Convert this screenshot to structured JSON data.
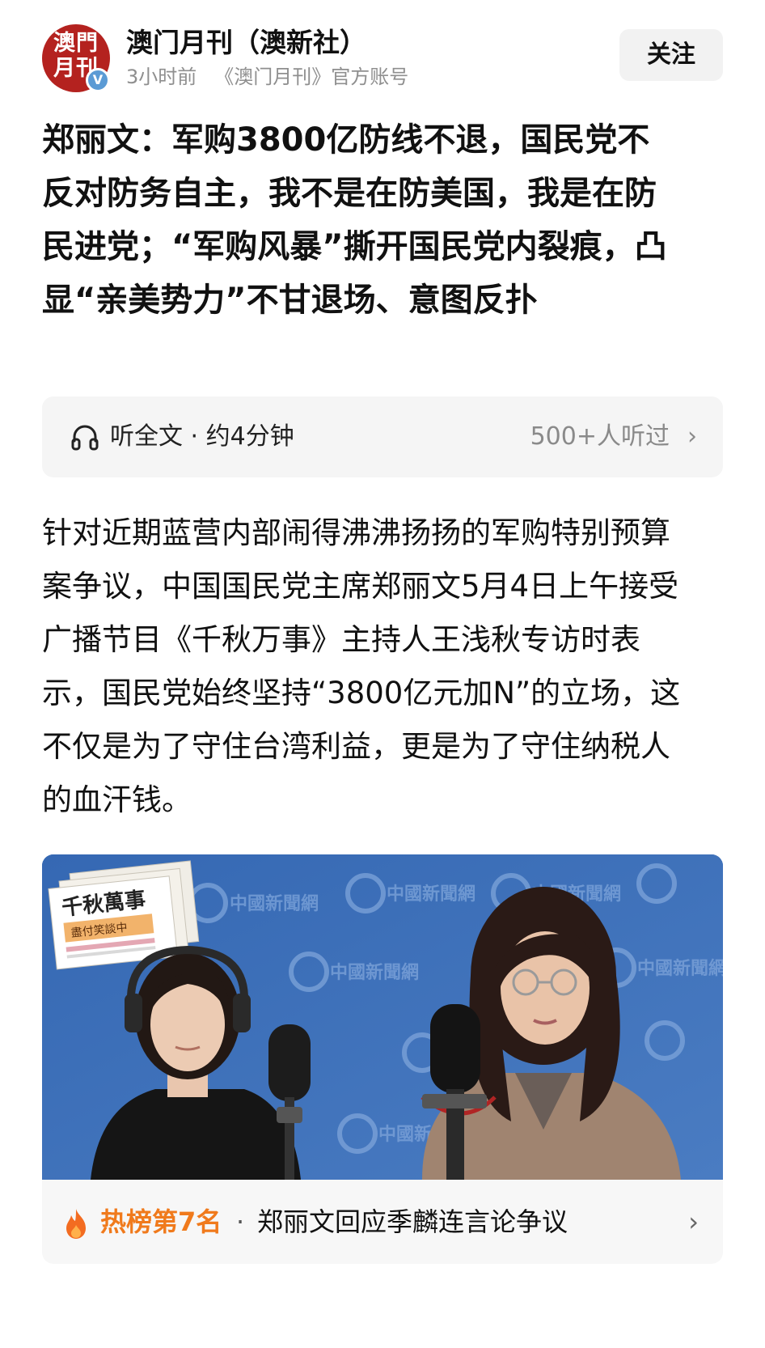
{
  "header": {
    "avatar_logo": "澳門月刊",
    "verified_badge": "V",
    "account_name": "澳门月刊（澳新社）",
    "time": "3小时前",
    "source": "《澳门月刊》官方账号",
    "follow_label": "关注"
  },
  "article": {
    "title": "郑丽文：军购3800亿防线不退，国民党不反对防务自主，我不是在防美国，我是在防民进党；“军购风暴”撕开国民党内裂痕，凸显“亲美势力”不甘退场、意图反扑",
    "body": "针对近期蓝营内部闹得沸沸扬扬的军购特别预算案争议，中国国民党主席郑丽文5月4日上午接受广播节目《千秋万事》主持人王浅秋专访时表示，国民党始终坚持“3800亿元加N”的立场，这不仅是为了守住台湾利益，更是为了守住纳税人的血汗钱。"
  },
  "listen": {
    "icon": "headphones-icon",
    "label": "听全文 · 约4分钟",
    "count": "500+人听过",
    "chevron": "›"
  },
  "image": {
    "show_logo_title": "千秋萬事",
    "show_logo_subtitle": "盡付笑談中",
    "watermark": "中國新聞網"
  },
  "hot_list": {
    "icon": "flame-icon",
    "rank": "热榜第7名",
    "dot": "·",
    "topic": "郑丽文回应季麟连言论争议",
    "chevron": "›"
  },
  "colors": {
    "avatar_red": "#b4221f",
    "verified_blue": "#5b9bd5",
    "hot_orange": "#f07a1c",
    "studio_blue": "#3e6fb6"
  }
}
